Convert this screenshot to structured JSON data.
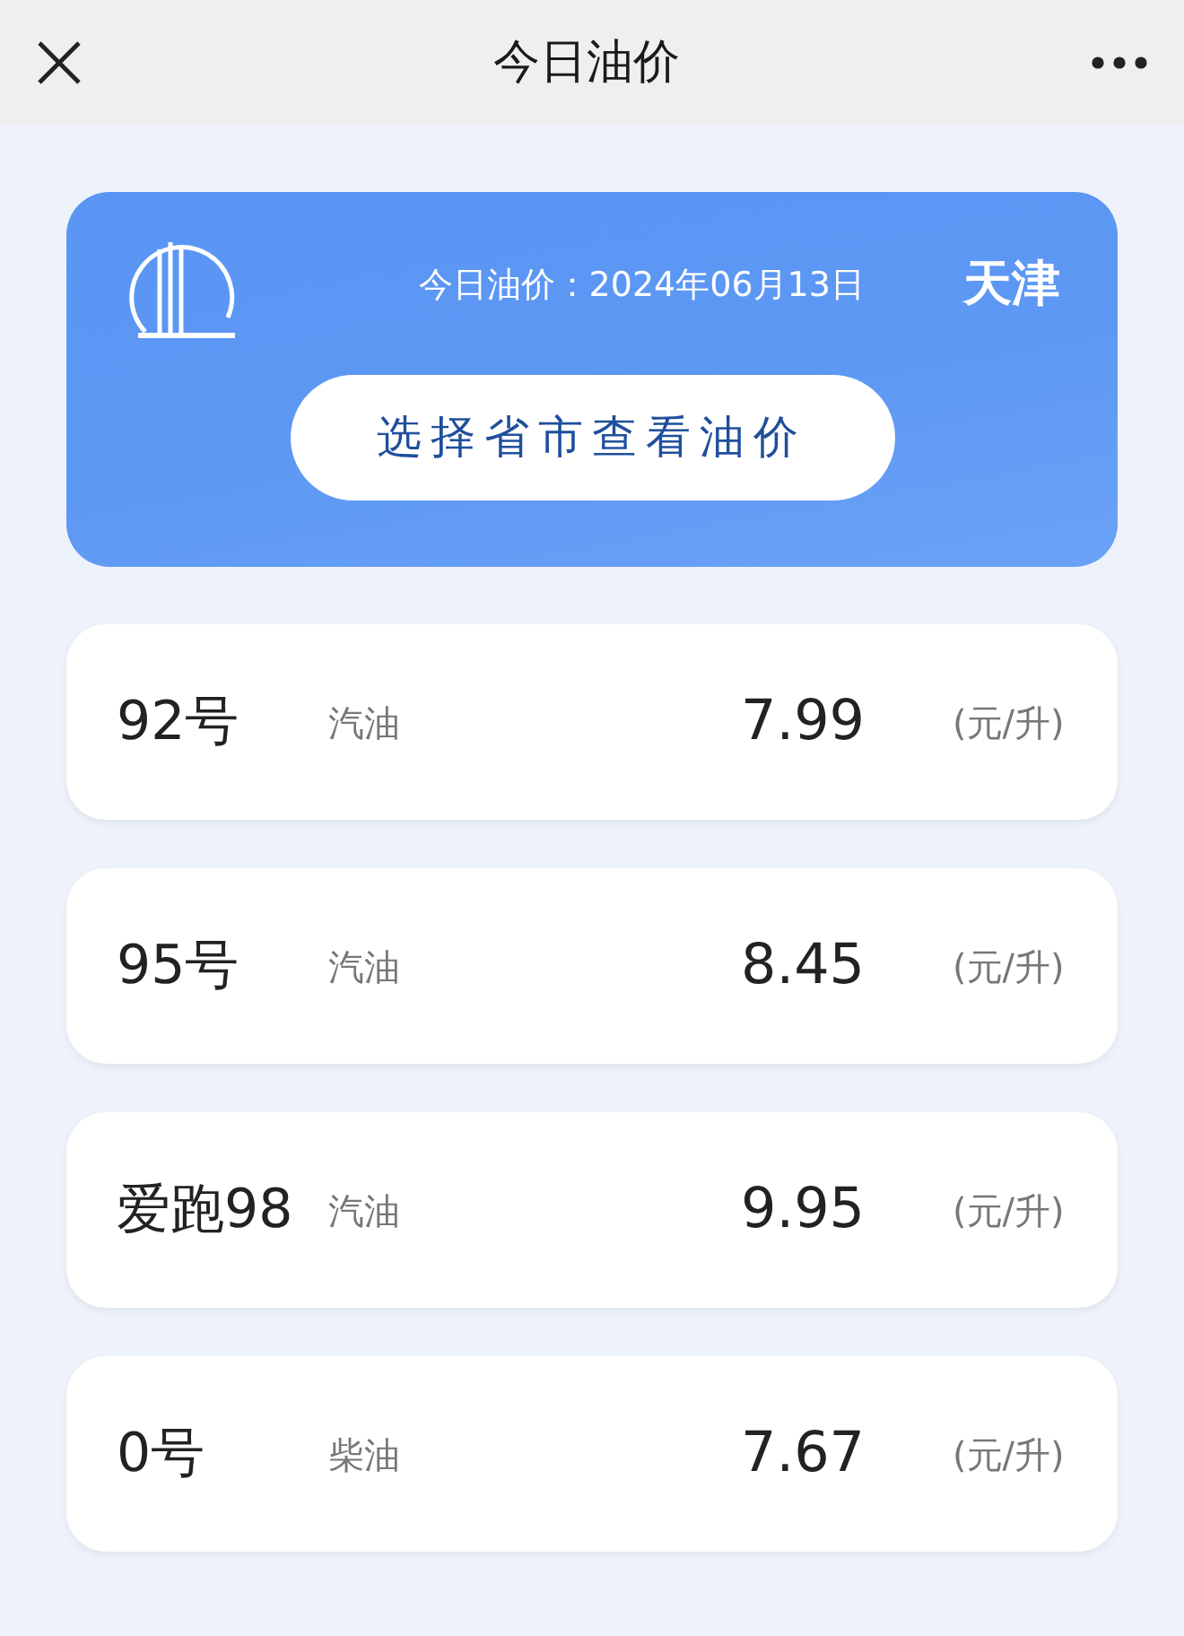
{
  "header": {
    "title": "今日油价"
  },
  "banner": {
    "date_text": "今日油价：2024年06月13日",
    "city": "天津",
    "button": "选择省市查看油价"
  },
  "prices": [
    {
      "grade": "92号",
      "fuel": "汽油",
      "price": "7.99",
      "unit": "(元/升)"
    },
    {
      "grade": "95号",
      "fuel": "汽油",
      "price": "8.45",
      "unit": "(元/升)"
    },
    {
      "grade": "爱跑98",
      "fuel": "汽油",
      "price": "9.95",
      "unit": "(元/升)"
    },
    {
      "grade": "0号",
      "fuel": "柴油",
      "price": "7.67",
      "unit": "(元/升)"
    }
  ]
}
